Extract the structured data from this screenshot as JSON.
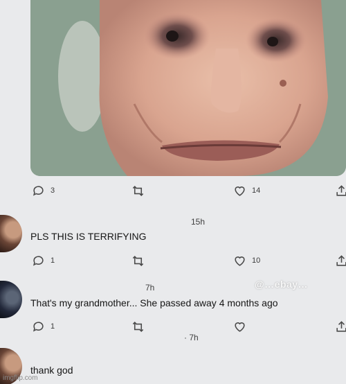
{
  "tweet": {
    "reply_count": "3",
    "like_count": "14"
  },
  "replies": [
    {
      "time": "15h",
      "text": "PLS THIS IS TERRIFYING",
      "reply_count": "1",
      "like_count": "10"
    },
    {
      "time": "7h",
      "text": "That's my grandmother... She passed away 4 months ago",
      "reply_count": "1",
      "like_count": ""
    },
    {
      "time": "· 7h",
      "text": "thank god"
    }
  ],
  "watermark": "@…ebay…",
  "footer_watermark": "imgflip.com",
  "icons": [
    "reply-icon",
    "retweet-icon",
    "heart-icon",
    "share-icon"
  ],
  "colors": {
    "background": "#e9eaec",
    "icon": "#4a4a4a",
    "text": "#151515"
  }
}
